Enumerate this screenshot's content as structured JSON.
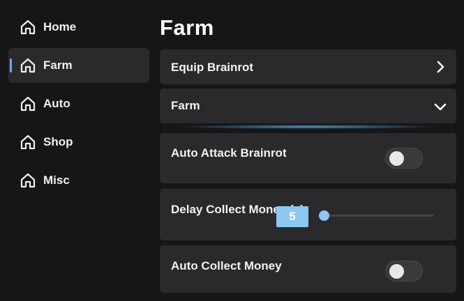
{
  "sidebar": {
    "items": [
      {
        "label": "Home",
        "icon": "home-icon",
        "active": false
      },
      {
        "label": "Farm",
        "icon": "home-icon",
        "active": true
      },
      {
        "label": "Auto",
        "icon": "home-icon",
        "active": false
      },
      {
        "label": "Shop",
        "icon": "home-icon",
        "active": false
      },
      {
        "label": "Misc",
        "icon": "home-icon",
        "active": false
      }
    ]
  },
  "main": {
    "title": "Farm",
    "equip_row": {
      "label": "Equip Brainrot",
      "icon": "chevron-right-icon"
    },
    "section": {
      "label": "Farm",
      "icon": "chevron-down-icon",
      "expanded": true
    },
    "auto_attack": {
      "label": "Auto Attack Brainrot",
      "enabled": false
    },
    "delay_collect": {
      "label": "Delay Collect Money (s)",
      "value": "5"
    },
    "auto_collect": {
      "label": "Auto Collect Money",
      "enabled": false
    }
  },
  "colors": {
    "accent": "#6aa6ff",
    "slider": "#8cc8f2",
    "card": "#2a2a2c",
    "background": "#1a1a1b"
  }
}
